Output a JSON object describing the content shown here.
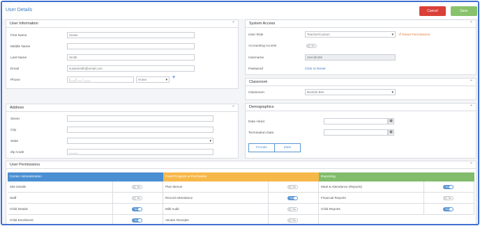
{
  "header": {
    "title": "User Details",
    "cancel_label": "Cancel",
    "save_label": "Save"
  },
  "user_information": {
    "title": "User Information",
    "first_name_label": "First Name",
    "first_name_value": "Susan",
    "middle_name_label": "Middle Name",
    "middle_name_value": "",
    "last_name_label": "Last Name",
    "last_name_value": "Smith",
    "email_label": "Email",
    "email_value": "susansmith@email.com",
    "phone_label": "Phone",
    "phone_placeholder": "(___) ___-____",
    "phone_type": "Home"
  },
  "address": {
    "title": "Address",
    "street_label": "Street",
    "city_label": "City",
    "state_label": "State",
    "zip_label": "Zip Code",
    "zip_placeholder": "_____"
  },
  "system_access": {
    "title": "System Access",
    "role_label": "User Role",
    "role_value": "Teacher/Custom",
    "reset_permissions": "Reset Permissions",
    "accounting_label": "Accounting Access",
    "accounting_toggle": "No",
    "accounting_on": false,
    "username_label": "Username",
    "username_value": "SSmith496",
    "password_label": "Password",
    "password_link": "Click to Reset"
  },
  "classroom": {
    "title": "Classroom",
    "label": "Classroom",
    "value": "Bumble Bee"
  },
  "demographics": {
    "title": "Demographics",
    "date_hired_label": "Date Hired",
    "termination_label": "Termination Date",
    "female_label": "Female",
    "male_label": "Male"
  },
  "permissions": {
    "title": "User Permissions",
    "colors": {
      "center": "#4a8fd2",
      "program": "#f7b84a",
      "reporting": "#82bc6c"
    },
    "columns": [
      {
        "header": "Center Administration",
        "rows": [
          {
            "name": "Site Details",
            "toggle": "No",
            "on": false
          },
          {
            "name": "Staff",
            "toggle": "No",
            "on": false
          },
          {
            "name": "Child Details",
            "toggle": "Yes",
            "on": true
          },
          {
            "name": "Child Enrollment",
            "toggle": "Yes",
            "on": true
          }
        ]
      },
      {
        "header": "Food Program & Purchases",
        "rows": [
          {
            "name": "Plan Menus",
            "toggle": "No",
            "on": false
          },
          {
            "name": "Record Attendance",
            "toggle": "Yes",
            "on": true
          },
          {
            "name": "Milk Audit",
            "toggle": "No",
            "on": false
          },
          {
            "name": "Vendor Receipts",
            "toggle": "No",
            "on": false
          }
        ]
      },
      {
        "header": "Reporting",
        "rows": [
          {
            "name": "Meal & Attendance (Reports)",
            "toggle": "Yes",
            "on": true
          },
          {
            "name": "Financial Reports",
            "toggle": "No",
            "on": false
          },
          {
            "name": "Child Reports",
            "toggle": "Yes",
            "on": true
          }
        ]
      }
    ]
  }
}
